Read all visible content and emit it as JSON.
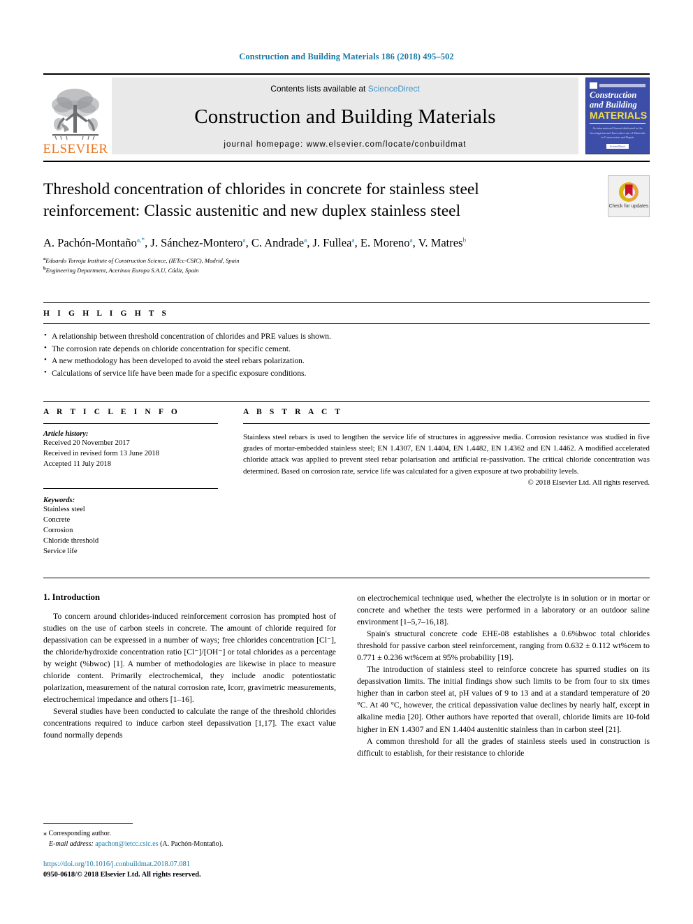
{
  "running_head": "Construction and Building Materials 186 (2018) 495–502",
  "masthead": {
    "publisher_name": "ELSEVIER",
    "contents_prefix": "Contents lists available at ",
    "contents_link": "ScienceDirect",
    "journal_title": "Construction and Building Materials",
    "homepage": "journal homepage: www.elsevier.com/locate/conbuildmat",
    "cover": {
      "line1": "Construction",
      "line2": "and Building",
      "line3": "MATERIALS",
      "blurb": "An international Journal dedicated to the Investigation and Innovative use of Materials in Construction and Repair",
      "footer_mark": "ScienceDirect"
    }
  },
  "article": {
    "title": "Threshold concentration of chlorides in concrete for stainless steel reinforcement: Classic austenitic and new duplex stainless steel",
    "crossmark_label": "Check for updates",
    "authors": [
      {
        "name": "A. Pachón-Montaño",
        "marks": "a,*"
      },
      {
        "name": "J. Sánchez-Montero",
        "marks": "a"
      },
      {
        "name": "C. Andrade",
        "marks": "a"
      },
      {
        "name": "J. Fullea",
        "marks": "a"
      },
      {
        "name": "E. Moreno",
        "marks": "a"
      },
      {
        "name": "V. Matres",
        "marks": "b"
      }
    ],
    "affiliations": [
      {
        "mark": "a",
        "text": "Eduardo Torroja Institute of Construction Science, (IETcc-CSIC), Madrid, Spain"
      },
      {
        "mark": "b",
        "text": "Engineering Department, Acerinox Europa S.A.U, Cádiz, Spain"
      }
    ]
  },
  "highlights": {
    "label": "H I G H L I G H T S",
    "items": [
      "A relationship between threshold concentration of chlorides and PRE values is shown.",
      "The corrosion rate depends on chloride concentration for specific cement.",
      "A new methodology has been developed to avoid the steel rebars polarization.",
      "Calculations of service life have been made for a specific exposure conditions."
    ]
  },
  "article_info": {
    "label": "A R T I C L E    I N F O",
    "history_title": "Article history:",
    "history": [
      "Received 20 November 2017",
      "Received in revised form 13 June 2018",
      "Accepted 11 July 2018"
    ],
    "keywords_title": "Keywords:",
    "keywords": [
      "Stainless steel",
      "Concrete",
      "Corrosion",
      "Chloride threshold",
      "Service life"
    ]
  },
  "abstract": {
    "label": "A B S T R A C T",
    "text": "Stainless steel rebars is used to lengthen the service life of structures in aggressive media. Corrosion resistance was studied in five grades of mortar-embedded stainless steel; EN 1.4307, EN 1.4404, EN 1.4482, EN 1.4362 and EN 1.4462. A modified accelerated chloride attack was applied to prevent steel rebar polarisation and artificial re-passivation. The critical chloride concentration was determined. Based on corrosion rate, service life was calculated for a given exposure at two probability levels.",
    "copyright": "© 2018 Elsevier Ltd. All rights reserved."
  },
  "body": {
    "section_title": "1. Introduction",
    "left_paragraphs": [
      "To concern around chlorides-induced reinforcement corrosion has prompted host of studies on the use of carbon steels in concrete. The amount of chloride required for depassivation can be expressed in a number of ways; free chlorides concentration [Cl⁻], the chloride/hydroxide concentration ratio [Cl⁻]/[OH⁻] or total chlorides as a percentage by weight (%bwoc) [1]. A number of methodologies are likewise in place to measure chloride content. Primarily electrochemical, they include anodic potentiostatic polarization, measurement of the natural corrosion rate, Icorr, gravimetric measurements, electrochemical impedance and others [1–16].",
      "Several studies have been conducted to calculate the range of the threshold chlorides concentrations required to induce carbon steel depassivation [1,17]. The exact value found normally depends"
    ],
    "right_paragraphs": [
      "on electrochemical technique used, whether the electrolyte is in solution or in mortar or concrete and whether the tests were performed in a laboratory or an outdoor saline environment [1–5,7–16,18].",
      "Spain's structural concrete code EHE-08 establishes a 0.6%bwoc total chlorides threshold for passive carbon steel reinforcement, ranging from 0.632 ± 0.112 wt%cem to 0.771 ± 0.236 wt%cem at 95% probability [19].",
      "The introduction of stainless steel to reinforce concrete has spurred studies on its depassivation limits. The initial findings show such limits to be from four to six times higher than in carbon steel at, pH values of 9 to 13 and at a standard temperature of 20 °C. At 40 °C, however, the critical depassivation value declines by nearly half, except in alkaline media [20]. Other authors have reported that overall, chloride limits are 10-fold higher in EN 1.4307 and EN 1.4404 austenitic stainless than in carbon steel [21].",
      "A common threshold for all the grades of stainless steels used in construction is difficult to establish, for their resistance to chloride"
    ]
  },
  "footnote": {
    "corresponding": "⁎  Corresponding author.",
    "email_label": "E-mail address:",
    "email": "apachon@ietcc.csic.es",
    "email_suffix": " (A. Pachón-Montaño).",
    "doi": "https://doi.org/10.1016/j.conbuildmat.2018.07.081",
    "issn": "0950-0618/© 2018 Elsevier Ltd. All rights reserved."
  },
  "colors": {
    "link_blue": "#1a7ba8",
    "elsevier_orange": "#e87722",
    "cover_blue": "#3c4ea8",
    "cover_yellow": "#f4e04d"
  }
}
